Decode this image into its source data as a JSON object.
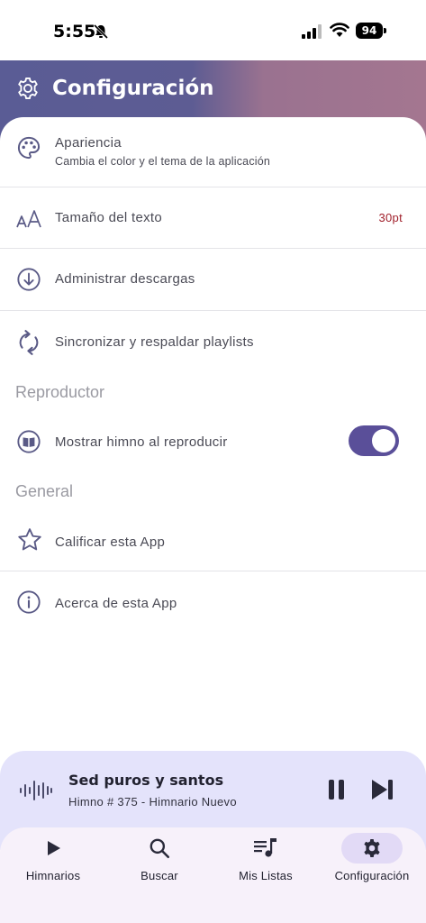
{
  "status_bar": {
    "time": "5:55",
    "battery": "94",
    "icons": [
      "bell-slash-icon",
      "signal-icon",
      "wifi-icon",
      "battery-icon"
    ]
  },
  "header": {
    "title": "Configuración",
    "icon": "gear-icon",
    "gradient": [
      "#5a5c95",
      "#a47690"
    ]
  },
  "settings": {
    "appearance": {
      "title": "Apariencia",
      "subtitle": "Cambia el color y el tema de la aplicación",
      "icon": "palette-icon"
    },
    "text_size": {
      "title": "Tamaño del texto",
      "value": "30pt",
      "icon": "text-size-icon"
    },
    "downloads": {
      "title": "Administrar descargas",
      "icon": "download-icon"
    },
    "sync": {
      "title": "Sincronizar y respaldar playlists",
      "icon": "sync-icon"
    },
    "section_player": "Reproductor",
    "show_hymn": {
      "title": "Mostrar himno al reproducir",
      "icon": "book-icon",
      "enabled": true
    },
    "section_general": "General",
    "rate": {
      "title": "Calificar esta App",
      "icon": "star-icon"
    },
    "about": {
      "title": "Acerca de esta App",
      "icon": "info-icon"
    }
  },
  "player": {
    "title": "Sed puros y santos",
    "subtitle": "Himno # 375 - Himnario Nuevo",
    "state": "playing"
  },
  "nav": {
    "items": [
      {
        "label": "Himnarios",
        "icon": "play-icon",
        "active": false
      },
      {
        "label": "Buscar",
        "icon": "search-icon",
        "active": false
      },
      {
        "label": "Mis Listas",
        "icon": "playlist-icon",
        "active": false
      },
      {
        "label": "Configuración",
        "icon": "gear-icon",
        "active": true
      }
    ]
  },
  "colors": {
    "accent": "#5a4f99",
    "value_red": "#a01f2a",
    "player_bg": "#e4e3fb",
    "nav_bg": "#f7f1fa"
  }
}
